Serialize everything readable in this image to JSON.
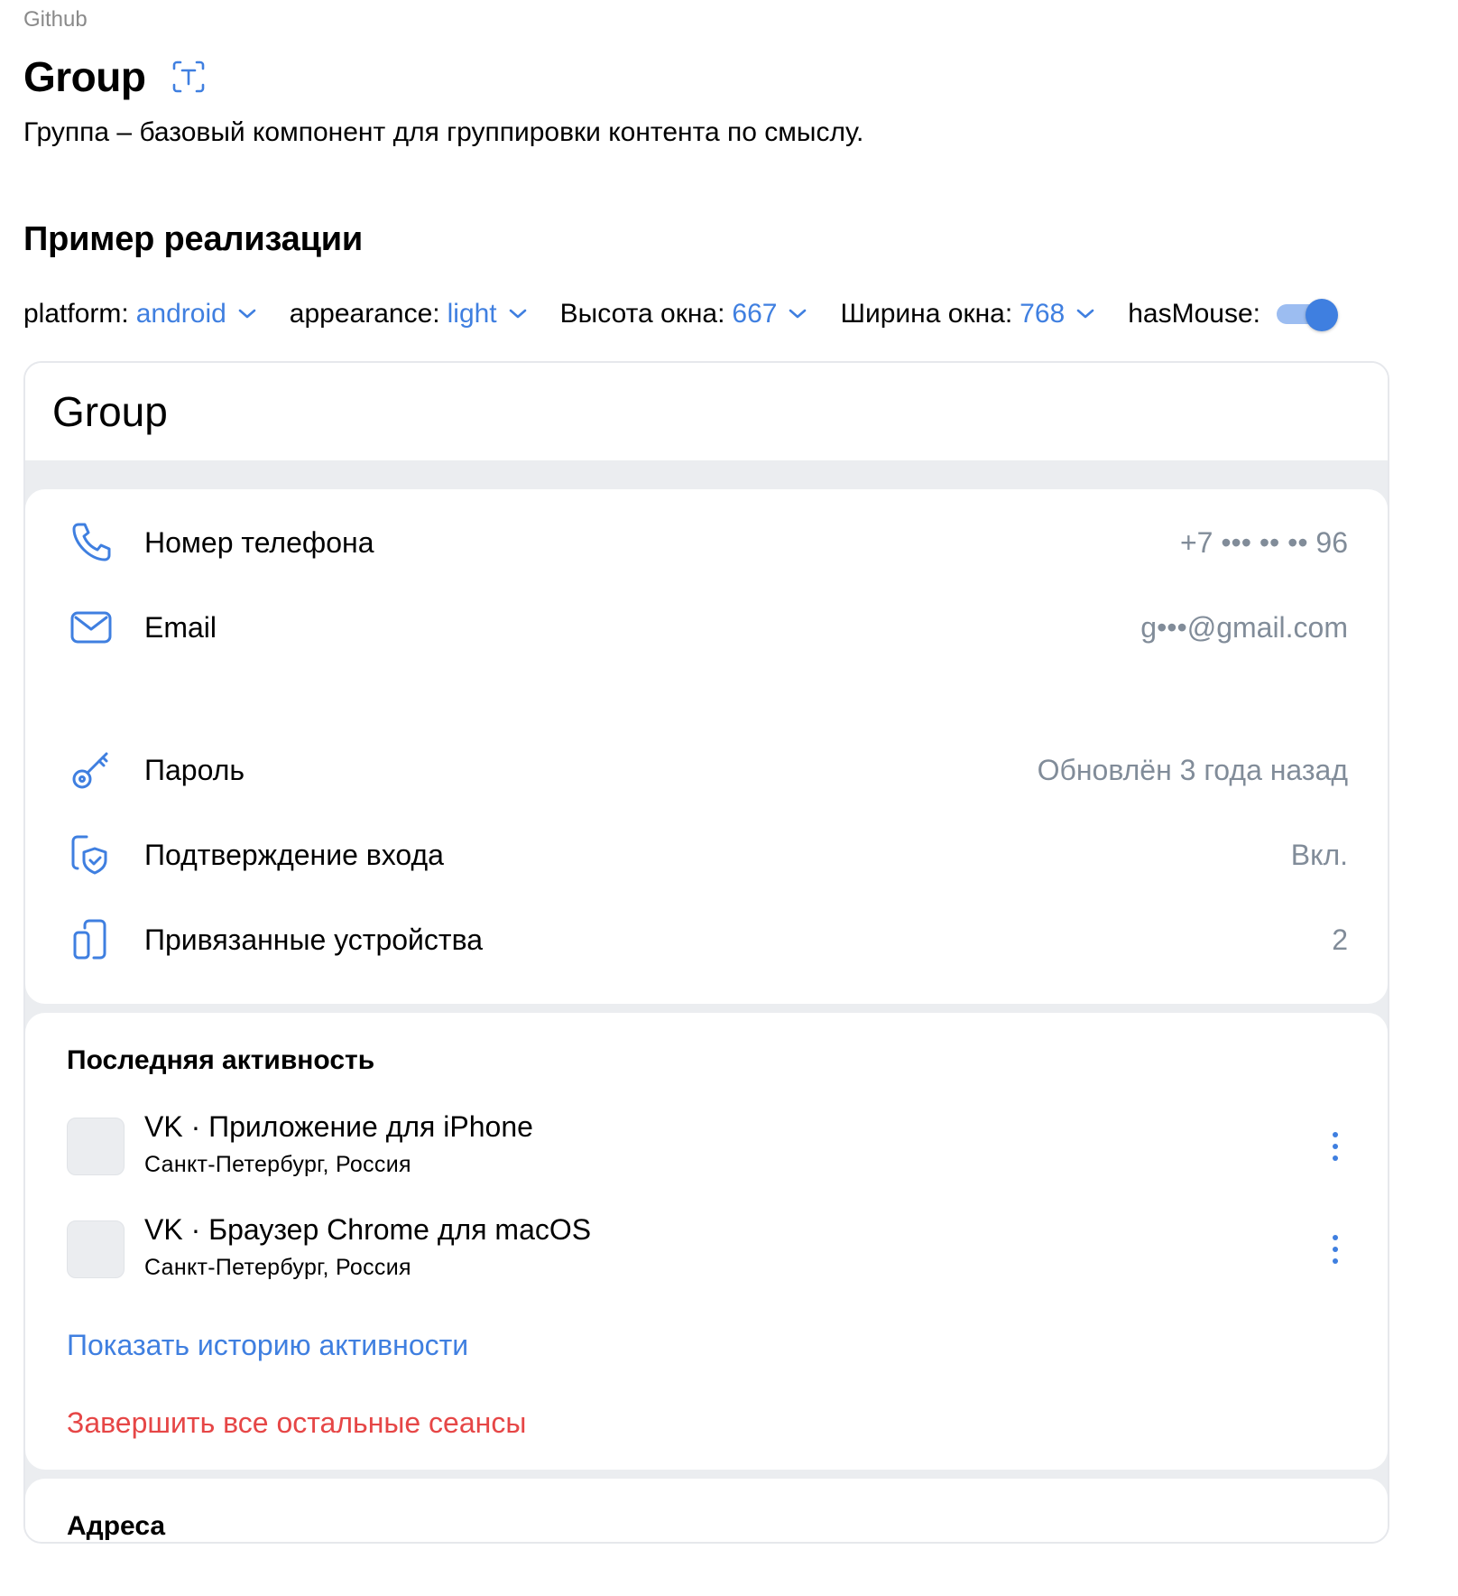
{
  "header": {
    "github_link": "Github",
    "title": "Group",
    "description": "Группа – базовый компонент для группировки контента по смыслу.",
    "section_heading": "Пример реализации"
  },
  "controls": {
    "platform": {
      "label": "platform:",
      "value": "android"
    },
    "appearance": {
      "label": "appearance:",
      "value": "light"
    },
    "height": {
      "label": "Высота окна:",
      "value": "667"
    },
    "width": {
      "label": "Ширина окна:",
      "value": "768"
    },
    "has_mouse": {
      "label": "hasMouse:",
      "enabled": true
    }
  },
  "demo": {
    "header_title": "Group",
    "contacts": [
      {
        "icon": "phone-icon",
        "label": "Номер телефона",
        "value": "+7 ••• •• •• 96"
      },
      {
        "icon": "mail-icon",
        "label": "Email",
        "value": "g•••@gmail.com"
      }
    ],
    "security": [
      {
        "icon": "key-icon",
        "label": "Пароль",
        "value": "Обновлён 3 года назад"
      },
      {
        "icon": "shield-check-icon",
        "label": "Подтверждение входа",
        "value": "Вкл."
      },
      {
        "icon": "devices-icon",
        "label": "Привязанные устройства",
        "value": "2"
      }
    ],
    "activity": {
      "header": "Последняя активность",
      "sessions": [
        {
          "title": "VK · Приложение для iPhone",
          "subtitle": "Санкт-Петербург, Россия"
        },
        {
          "title": "VK · Браузер Chrome для macOS",
          "subtitle": "Санкт-Петербург, Россия"
        }
      ],
      "show_history": "Показать историю активности",
      "end_sessions": "Завершить все остальные сеансы"
    },
    "addresses_header": "Адреса"
  },
  "colors": {
    "accent": "#3f7fe0",
    "destructive": "#e64646",
    "secondary_text": "#818c99",
    "background": "#ebedf0"
  }
}
